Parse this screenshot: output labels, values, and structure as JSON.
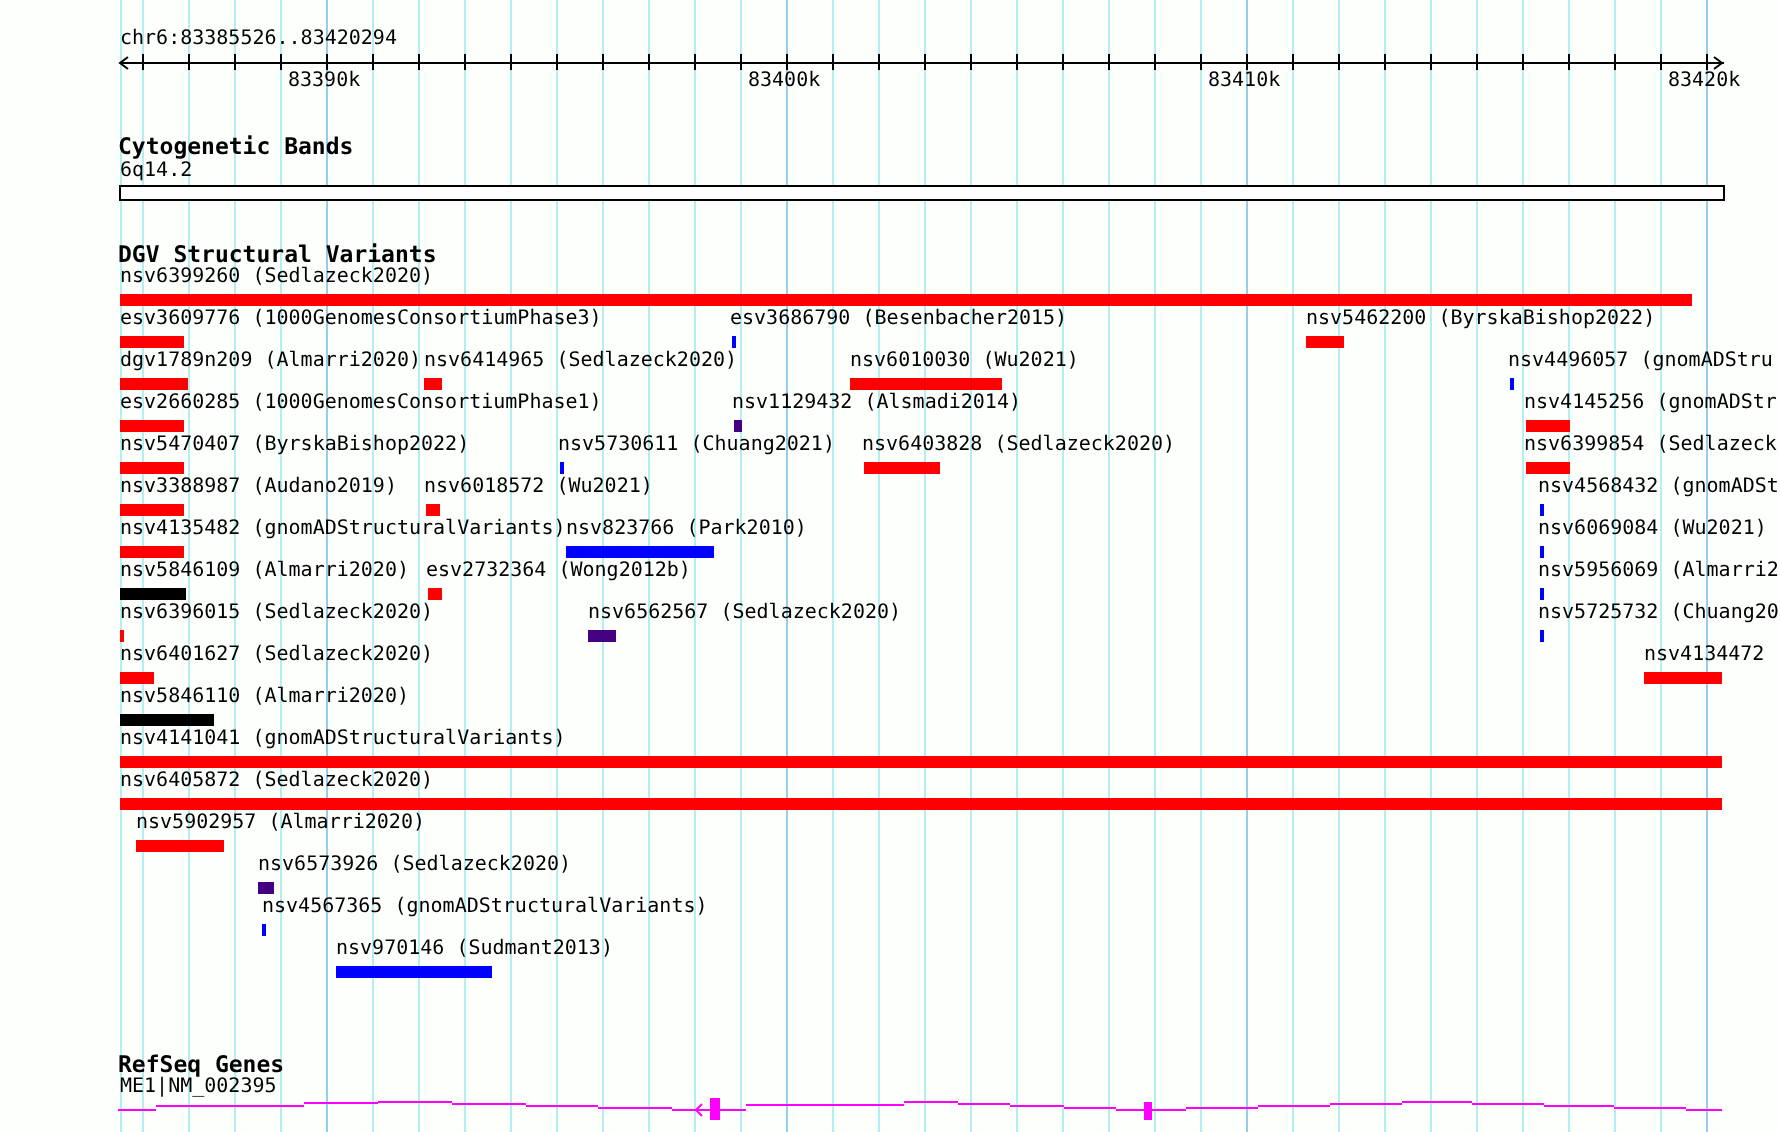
{
  "location": "chr6:83385526..83420294",
  "ruler": {
    "labels": [
      "83390k",
      "83400k",
      "83410k",
      "83420k"
    ]
  },
  "tracks": [
    {
      "kind": "cytoband",
      "title": "Cytogenetic Bands",
      "features": [
        {
          "label": "6q14.2"
        }
      ]
    },
    {
      "kind": "variants",
      "title": "DGV Structural Variants",
      "features": [
        {
          "label": "nsv6399260 (Sedlazeck2020)",
          "color": "#ff0000"
        },
        {
          "label": "esv3609776 (1000GenomesConsortiumPhase3)",
          "color": "#ff0000"
        },
        {
          "label": "esv3686790 (Besenbacher2015)",
          "color": "#0000ff"
        },
        {
          "label": "nsv5462200 (ByrskaBishop2022)",
          "color": "#ff0000"
        },
        {
          "label": "dgv1789n209 (Almarri2020)",
          "color": "#ff0000"
        },
        {
          "label": "nsv6414965 (Sedlazeck2020)",
          "color": "#ff0000"
        },
        {
          "label": "nsv6010030 (Wu2021)",
          "color": "#ff0000"
        },
        {
          "label": "nsv4496057 (gnomADStru",
          "color": "#0000ff"
        },
        {
          "label": "esv2660285 (1000GenomesConsortiumPhase1)",
          "color": "#ff0000"
        },
        {
          "label": "nsv1129432 (Alsmadi2014)",
          "color": "#440080"
        },
        {
          "label": "nsv4145256 (gnomADStr",
          "color": "#ff0000"
        },
        {
          "label": "nsv5470407 (ByrskaBishop2022)",
          "color": "#ff0000"
        },
        {
          "label": "nsv5730611 (Chuang2021)",
          "color": "#0000ff"
        },
        {
          "label": "nsv6403828 (Sedlazeck2020)",
          "color": "#ff0000"
        },
        {
          "label": "nsv6399854 (Sedlazeck",
          "color": "#ff0000"
        },
        {
          "label": "nsv3388987 (Audano2019)",
          "color": "#ff0000"
        },
        {
          "label": "nsv6018572 (Wu2021)",
          "color": "#ff0000"
        },
        {
          "label": "nsv4568432 (gnomADSt",
          "color": "#0000ff"
        },
        {
          "label": "nsv4135482 (gnomADStructuralVariants)",
          "color": "#ff0000"
        },
        {
          "label": "nsv823766 (Park2010)",
          "color": "#0000ff"
        },
        {
          "label": "nsv6069084 (Wu2021)",
          "color": "#0000ff"
        },
        {
          "label": "nsv5846109 (Almarri2020)",
          "color": "#000000"
        },
        {
          "label": "esv2732364 (Wong2012b)",
          "color": "#ff0000"
        },
        {
          "label": "nsv5956069 (Almarri2",
          "color": "#0000ff"
        },
        {
          "label": "nsv6396015 (Sedlazeck2020)",
          "color": "#ff0000"
        },
        {
          "label": "nsv6562567 (Sedlazeck2020)",
          "color": "#440080"
        },
        {
          "label": "nsv5725732 (Chuang20",
          "color": "#0000ff"
        },
        {
          "label": "nsv6401627 (Sedlazeck2020)",
          "color": "#ff0000"
        },
        {
          "label": "nsv4134472",
          "color": "#ff0000"
        },
        {
          "label": "nsv5846110 (Almarri2020)",
          "color": "#000000"
        },
        {
          "label": "nsv4141041 (gnomADStructuralVariants)",
          "color": "#ff0000"
        },
        {
          "label": "nsv6405872 (Sedlazeck2020)",
          "color": "#ff0000"
        },
        {
          "label": "nsv5902957 (Almarri2020)",
          "color": "#ff0000"
        },
        {
          "label": "nsv6573926 (Sedlazeck2020)",
          "color": "#440080"
        },
        {
          "label": "nsv4567365 (gnomADStructuralVariants)",
          "color": "#0000ff"
        },
        {
          "label": "nsv970146 (Sudmant2013)",
          "color": "#0000ff"
        }
      ]
    },
    {
      "kind": "gene",
      "title": "RefSeq Genes",
      "features": [
        {
          "label": "ME1|NM_002395"
        }
      ]
    }
  ]
}
